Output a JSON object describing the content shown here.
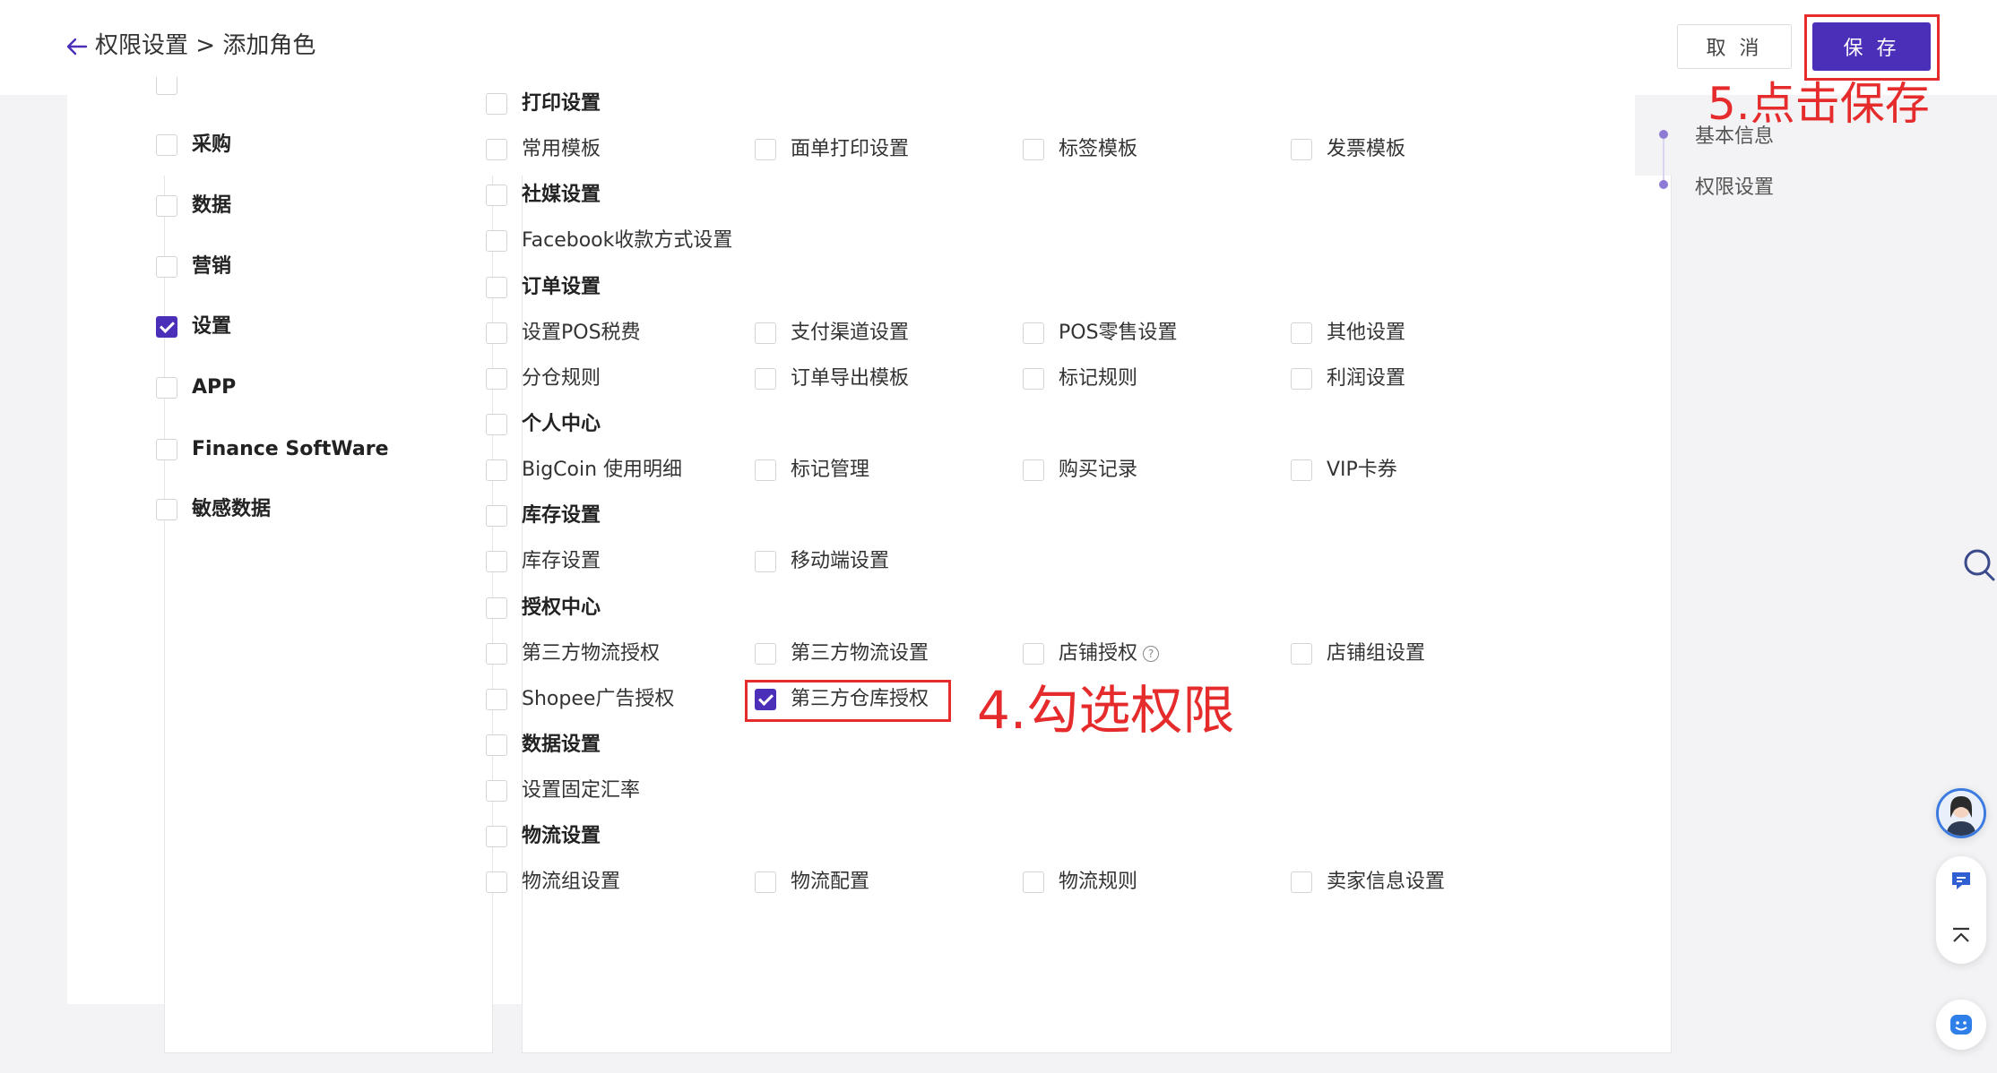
{
  "header": {
    "breadcrumb": "权限设置 > 添加角色",
    "cancel_label": "取 消",
    "save_label": "保 存"
  },
  "annotations": {
    "save_step": "5.点击保存",
    "check_step": "4.勾选权限"
  },
  "left_menu": [
    {
      "label": "采购",
      "checked": false
    },
    {
      "label": "数据",
      "checked": false
    },
    {
      "label": "营销",
      "checked": false
    },
    {
      "label": "设置",
      "checked": true
    },
    {
      "label": "APP",
      "checked": false
    },
    {
      "label": "Finance SoftWare",
      "checked": false
    },
    {
      "label": "敏感数据",
      "checked": false
    }
  ],
  "permissions": {
    "print": {
      "title": "打印设置",
      "items": [
        "常用模板",
        "面单打印设置",
        "标签模板",
        "发票模板"
      ]
    },
    "social": {
      "title": "社媒设置",
      "items": [
        "Facebook收款方式设置"
      ]
    },
    "order": {
      "title": "订单设置",
      "items": [
        "设置POS税费",
        "支付渠道设置",
        "POS零售设置",
        "其他设置",
        "分仓规则",
        "订单导出模板",
        "标记规则",
        "利润设置"
      ]
    },
    "personal": {
      "title": "个人中心",
      "items": [
        "BigCoin 使用明细",
        "标记管理",
        "购买记录",
        "VIP卡券"
      ]
    },
    "inventory": {
      "title": "库存设置",
      "items": [
        "库存设置",
        "移动端设置"
      ]
    },
    "auth": {
      "title": "授权中心",
      "items": [
        "第三方物流授权",
        "第三方物流设置",
        "店铺授权",
        "店铺组设置",
        "Shopee广告授权",
        "第三方仓库授权"
      ]
    },
    "data": {
      "title": "数据设置",
      "items": [
        "设置固定汇率"
      ]
    },
    "logistics": {
      "title": "物流设置",
      "items": [
        "物流组设置",
        "物流配置",
        "物流规则",
        "卖家信息设置"
      ]
    }
  },
  "checked_permission": "第三方仓库授权",
  "side_nav": [
    "基本信息",
    "权限设置"
  ],
  "colors": {
    "accent": "#4b2fb8",
    "annotation": "#e52b2b"
  }
}
